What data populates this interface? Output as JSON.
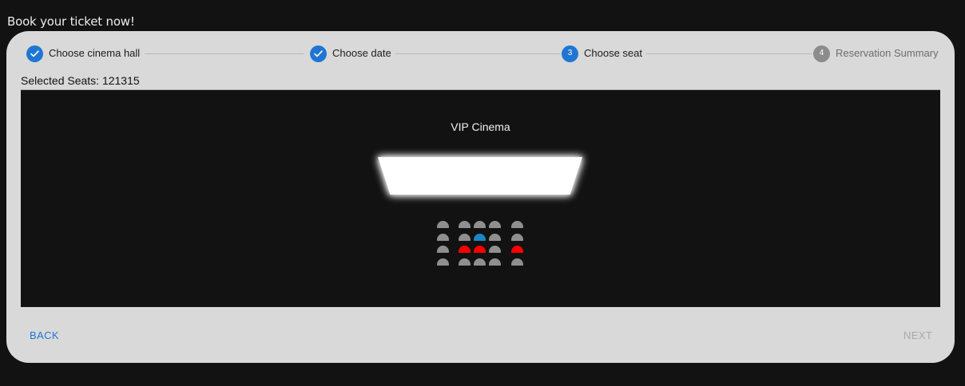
{
  "page": {
    "heading": "Book your ticket now!"
  },
  "stepper": {
    "steps": [
      {
        "label": "Choose cinema hall",
        "state": "completed",
        "icon": "check-icon"
      },
      {
        "label": "Choose date",
        "state": "completed",
        "icon": "check-icon"
      },
      {
        "label": "Choose seat",
        "state": "active",
        "number": "3"
      },
      {
        "label": "Reservation Summary",
        "state": "pending",
        "number": "4"
      }
    ]
  },
  "selection": {
    "label": "Selected Seats: 121315"
  },
  "hall": {
    "name": "VIP Cinema",
    "screen_icon": "cinema-screen",
    "seat_rows": [
      [
        "available",
        "available",
        "available",
        "available",
        "available"
      ],
      [
        "available",
        "available",
        "selected",
        "available",
        "available"
      ],
      [
        "available",
        "reserved",
        "reserved",
        "available",
        "reserved"
      ],
      [
        "available",
        "available",
        "available",
        "available",
        "available"
      ]
    ],
    "seat_colors": {
      "available": "#8f8f8f",
      "reserved": "#ff0000",
      "selected": "#1b86c6"
    }
  },
  "footer": {
    "back_label": "BACK",
    "next_label": "NEXT",
    "next_disabled": true
  },
  "colors": {
    "accent": "#1f76d2",
    "background": "#121212",
    "card": "#d9d9d9"
  }
}
